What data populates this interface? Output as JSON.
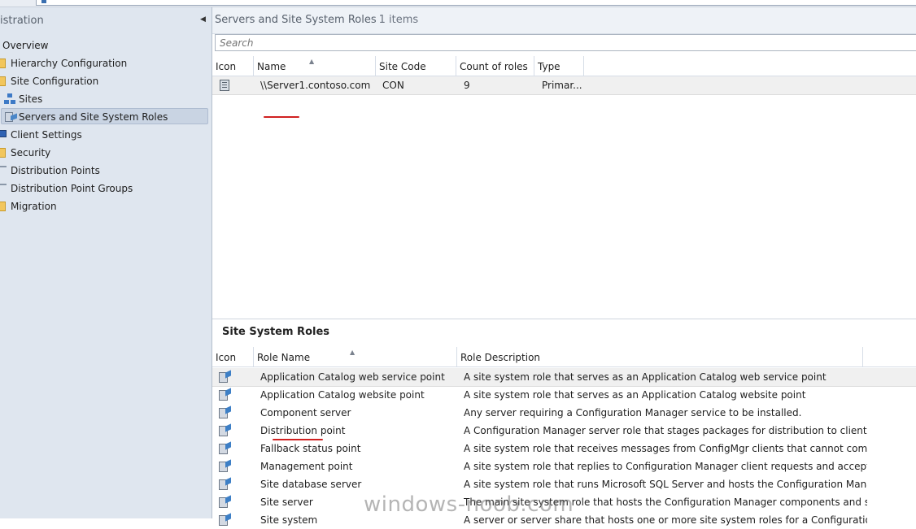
{
  "nav": {
    "title": "istration",
    "items": [
      {
        "label": "Overview"
      },
      {
        "label": "Hierarchy Configuration"
      },
      {
        "label": "Site Configuration"
      },
      {
        "label": "Sites"
      },
      {
        "label": "Servers and Site System Roles"
      },
      {
        "label": "Client Settings"
      },
      {
        "label": "Security"
      },
      {
        "label": "Distribution Points"
      },
      {
        "label": "Distribution Point Groups"
      },
      {
        "label": "Migration"
      }
    ]
  },
  "main": {
    "title": "Servers and Site System Roles",
    "count": "1 items",
    "search_placeholder": "Search",
    "columns": [
      "Icon",
      "Name",
      "Site Code",
      "Count of roles",
      "Type"
    ],
    "rows": [
      {
        "name": "\\\\Server1.contoso.com",
        "site_code": "CON",
        "count_of_roles": "9",
        "type": "Primar..."
      }
    ]
  },
  "roles": {
    "title": "Site System Roles",
    "columns": [
      "Icon",
      "Role Name",
      "Role Description"
    ],
    "rows": [
      {
        "name": "Application Catalog web service point",
        "description": "A site system role that serves as an Application Catalog web service point"
      },
      {
        "name": "Application Catalog website point",
        "description": "A site system role that serves as an Application Catalog website point"
      },
      {
        "name": "Component server",
        "description": "Any server requiring a Configuration Manager service to be installed."
      },
      {
        "name": "Distribution point",
        "description": "A Configuration Manager server role that stages packages for distribution to clients."
      },
      {
        "name": "Fallback status point",
        "description": "A site system role that receives messages from ConfigMgr clients that cannot communicat..."
      },
      {
        "name": "Management point",
        "description": "A site system role that replies to Configuration Manager client requests and accepts mana..."
      },
      {
        "name": "Site database server",
        "description": "A site system role that runs Microsoft SQL Server and hosts the Configuration Manager sit..."
      },
      {
        "name": "Site server",
        "description": "The main site system role that hosts the Configuration Manager components and services."
      },
      {
        "name": "Site system",
        "description": "A server or server share that hosts one or more site system roles for a Configuration Mana..."
      }
    ]
  },
  "watermark": "windows-noob.com",
  "colors": {
    "annotation": "#d02020",
    "selection": "#c9d4e3",
    "nav_bg": "#dfe6ef"
  }
}
